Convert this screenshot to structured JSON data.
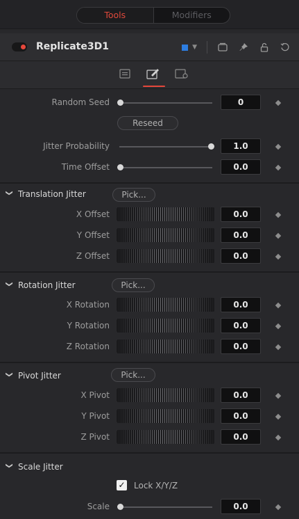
{
  "top_tabs": {
    "tools": "Tools",
    "modifiers": "Modifiers"
  },
  "header": {
    "tool_name": "Replicate3D1",
    "color_swatch": "#2d7de0"
  },
  "main": {
    "random_seed": {
      "label": "Random Seed",
      "value": "0"
    },
    "reseed": "Reseed",
    "jitter_probability": {
      "label": "Jitter Probability",
      "value": "1.0"
    },
    "time_offset": {
      "label": "Time Offset",
      "value": "0.0"
    }
  },
  "translation": {
    "title": "Translation Jitter",
    "pick": "Pick...",
    "x": {
      "label": "X Offset",
      "value": "0.0"
    },
    "y": {
      "label": "Y Offset",
      "value": "0.0"
    },
    "z": {
      "label": "Z Offset",
      "value": "0.0"
    }
  },
  "rotation": {
    "title": "Rotation Jitter",
    "pick": "Pick...",
    "x": {
      "label": "X Rotation",
      "value": "0.0"
    },
    "y": {
      "label": "Y Rotation",
      "value": "0.0"
    },
    "z": {
      "label": "Z Rotation",
      "value": "0.0"
    }
  },
  "pivot": {
    "title": "Pivot Jitter",
    "pick": "Pick...",
    "x": {
      "label": "X Pivot",
      "value": "0.0"
    },
    "y": {
      "label": "Y Pivot",
      "value": "0.0"
    },
    "z": {
      "label": "Z Pivot",
      "value": "0.0"
    }
  },
  "scale": {
    "title": "Scale Jitter",
    "lock_label": "Lock X/Y/Z",
    "lock_checked": true,
    "scale": {
      "label": "Scale",
      "value": "0.0"
    }
  },
  "icons": {
    "chevron": "chevron-down-icon",
    "collapse": "collapse-arrow-icon",
    "keyframe": "diamond-keyframe-icon",
    "pin": "pin-icon",
    "lock": "lock-icon",
    "reset": "reset-icon",
    "window": "window-icon"
  },
  "colors": {
    "accent": "#e6473b",
    "background": "#28282b"
  }
}
